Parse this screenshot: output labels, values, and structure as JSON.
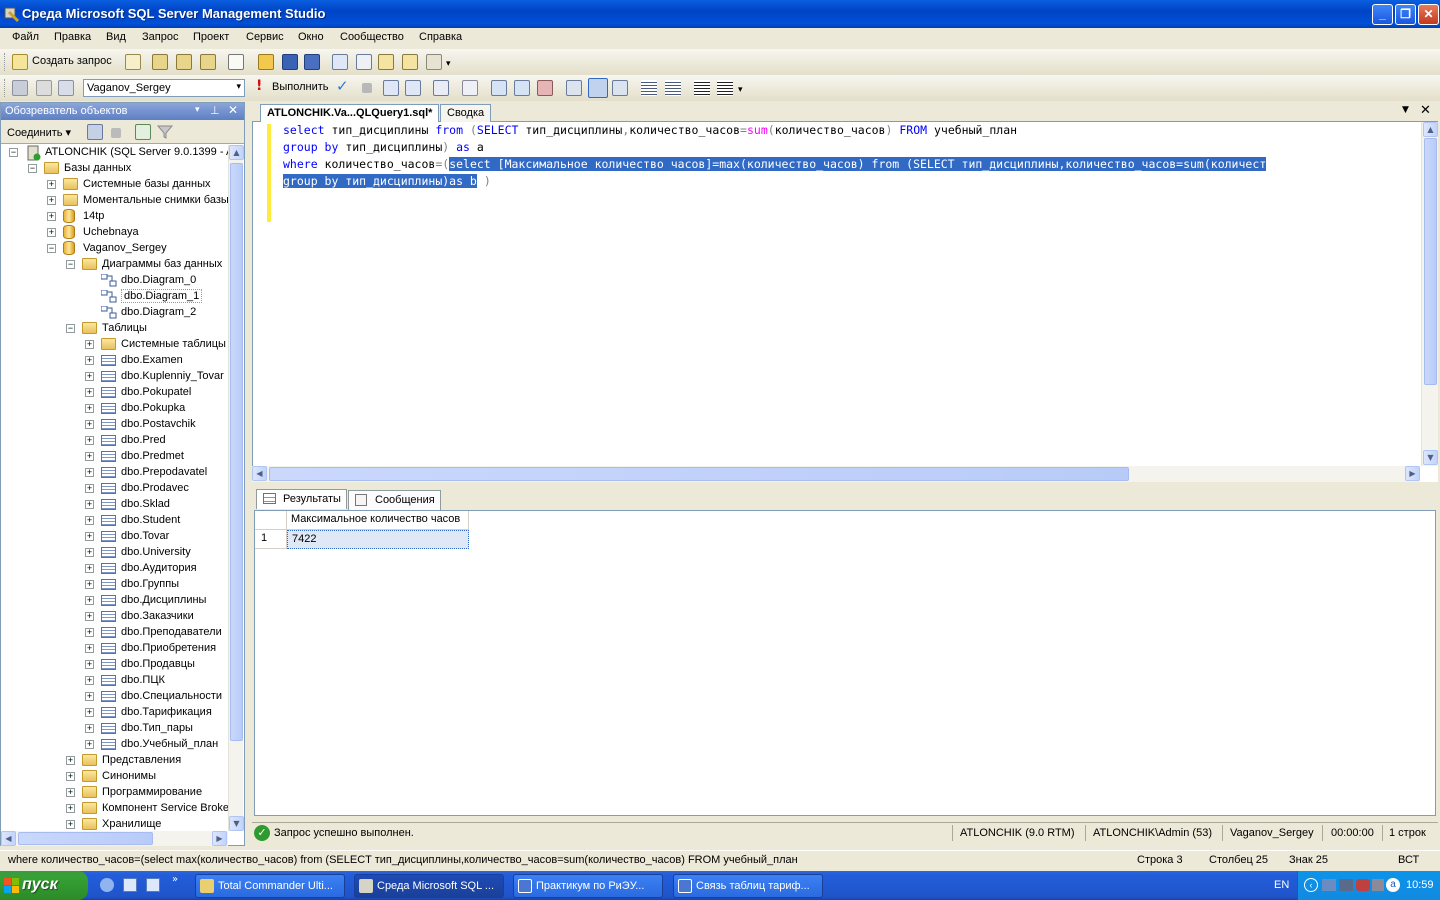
{
  "window": {
    "title": "Среда Microsoft SQL Server Management Studio",
    "buttons": {
      "minimize": "_",
      "maximize": "❐",
      "close": "✕"
    }
  },
  "menu": [
    "Файл",
    "Правка",
    "Вид",
    "Запрос",
    "Проект",
    "Сервис",
    "Окно",
    "Сообщество",
    "Справка"
  ],
  "toolbar1": {
    "new_query": "Создать запрос"
  },
  "toolbar2": {
    "database": "Vaganov_Sergey",
    "execute": "Выполнить"
  },
  "object_explorer": {
    "title": "Обозреватель объектов",
    "connect": "Соединить ▾",
    "tree": [
      {
        "label": "ATLONCHIK (SQL Server 9.0.1399 - A",
        "level": 0,
        "type": "server",
        "exp": "−"
      },
      {
        "label": "Базы данных",
        "level": 1,
        "type": "folder",
        "exp": "−"
      },
      {
        "label": "Системные базы данных",
        "level": 2,
        "type": "folder",
        "exp": "+"
      },
      {
        "label": "Моментальные снимки базы",
        "level": 2,
        "type": "folder",
        "exp": "+"
      },
      {
        "label": "14tp",
        "level": 2,
        "type": "db",
        "exp": "+"
      },
      {
        "label": "Uchebnaya",
        "level": 2,
        "type": "db",
        "exp": "+"
      },
      {
        "label": "Vaganov_Sergey",
        "level": 2,
        "type": "db",
        "exp": "−"
      },
      {
        "label": "Диаграммы баз данных",
        "level": 3,
        "type": "folder",
        "exp": "−"
      },
      {
        "label": "dbo.Diagram_0",
        "level": 4,
        "type": "diagram",
        "exp": ""
      },
      {
        "label": "dbo.Diagram_1",
        "level": 4,
        "type": "diagram",
        "exp": ""
      },
      {
        "label": "dbo.Diagram_2",
        "level": 4,
        "type": "diagram",
        "exp": ""
      },
      {
        "label": "Таблицы",
        "level": 3,
        "type": "folder",
        "exp": "−"
      },
      {
        "label": "Системные таблицы",
        "level": 4,
        "type": "folder",
        "exp": "+"
      },
      {
        "label": "dbo.Examen",
        "level": 4,
        "type": "table",
        "exp": "+"
      },
      {
        "label": "dbo.Kuplenniy_Tovar",
        "level": 4,
        "type": "table",
        "exp": "+"
      },
      {
        "label": "dbo.Pokupatel",
        "level": 4,
        "type": "table",
        "exp": "+"
      },
      {
        "label": "dbo.Pokupka",
        "level": 4,
        "type": "table",
        "exp": "+"
      },
      {
        "label": "dbo.Postavchik",
        "level": 4,
        "type": "table",
        "exp": "+"
      },
      {
        "label": "dbo.Pred",
        "level": 4,
        "type": "table",
        "exp": "+"
      },
      {
        "label": "dbo.Predmet",
        "level": 4,
        "type": "table",
        "exp": "+"
      },
      {
        "label": "dbo.Prepodavatel",
        "level": 4,
        "type": "table",
        "exp": "+"
      },
      {
        "label": "dbo.Prodavec",
        "level": 4,
        "type": "table",
        "exp": "+"
      },
      {
        "label": "dbo.Sklad",
        "level": 4,
        "type": "table",
        "exp": "+"
      },
      {
        "label": "dbo.Student",
        "level": 4,
        "type": "table",
        "exp": "+"
      },
      {
        "label": "dbo.Tovar",
        "level": 4,
        "type": "table",
        "exp": "+"
      },
      {
        "label": "dbo.University",
        "level": 4,
        "type": "table",
        "exp": "+"
      },
      {
        "label": "dbo.Аудитория",
        "level": 4,
        "type": "table",
        "exp": "+"
      },
      {
        "label": "dbo.Группы",
        "level": 4,
        "type": "table",
        "exp": "+"
      },
      {
        "label": "dbo.Дисциплины",
        "level": 4,
        "type": "table",
        "exp": "+"
      },
      {
        "label": "dbo.Заказчики",
        "level": 4,
        "type": "table",
        "exp": "+"
      },
      {
        "label": "dbo.Преподаватели",
        "level": 4,
        "type": "table",
        "exp": "+"
      },
      {
        "label": "dbo.Приобретения",
        "level": 4,
        "type": "table",
        "exp": "+"
      },
      {
        "label": "dbo.Продавцы",
        "level": 4,
        "type": "table",
        "exp": "+"
      },
      {
        "label": "dbo.ПЦК",
        "level": 4,
        "type": "table",
        "exp": "+"
      },
      {
        "label": "dbo.Специальности",
        "level": 4,
        "type": "table",
        "exp": "+"
      },
      {
        "label": "dbo.Тарификация",
        "level": 4,
        "type": "table",
        "exp": "+"
      },
      {
        "label": "dbo.Тип_пары",
        "level": 4,
        "type": "table",
        "exp": "+"
      },
      {
        "label": "dbo.Учебный_план",
        "level": 4,
        "type": "table",
        "exp": "+"
      },
      {
        "label": "Представления",
        "level": 3,
        "type": "folder",
        "exp": "+"
      },
      {
        "label": "Синонимы",
        "level": 3,
        "type": "folder",
        "exp": "+"
      },
      {
        "label": "Программирование",
        "level": 3,
        "type": "folder",
        "exp": "+"
      },
      {
        "label": "Компонент Service Broke",
        "level": 3,
        "type": "folder",
        "exp": "+"
      },
      {
        "label": "Хранилище",
        "level": 3,
        "type": "folder",
        "exp": "+"
      }
    ]
  },
  "editor": {
    "tabs": [
      "ATLONCHIK.Va...QLQuery1.sql*",
      "Сводка"
    ],
    "lines": [
      [
        [
          "kw",
          "select"
        ],
        [
          "t",
          " тип_дисциплины "
        ],
        [
          "kw",
          "from"
        ],
        [
          "t",
          " "
        ],
        [
          "gr",
          "("
        ],
        [
          "kw",
          "SELECT"
        ],
        [
          "t",
          " тип_дисциплины"
        ],
        [
          "gr",
          ","
        ],
        [
          "t",
          "количество_часов"
        ],
        [
          "gr",
          "="
        ],
        [
          "fn",
          "sum"
        ],
        [
          "gr",
          "("
        ],
        [
          "t",
          "количество_часов"
        ],
        [
          "gr",
          ")"
        ],
        [
          "t",
          " "
        ],
        [
          "kw",
          "FROM"
        ],
        [
          "t",
          " учебный_план"
        ]
      ],
      [
        [
          "kw",
          "group by"
        ],
        [
          "t",
          " тип_дисциплины"
        ],
        [
          "gr",
          ")"
        ],
        [
          "t",
          " "
        ],
        [
          "kw",
          "as"
        ],
        [
          "t",
          " a"
        ]
      ],
      [
        [
          "kw",
          "where"
        ],
        [
          "t",
          " количество_часов"
        ],
        [
          "gr",
          "=("
        ],
        [
          "sel",
          "select [Максимальное количество часов]=max(количество_часов) from (SELECT тип_дисциплины,количество_часов=sum(количест"
        ]
      ],
      [
        [
          "sel",
          "group by тип_дисциплины)as b"
        ],
        [
          "t",
          " "
        ],
        [
          "gr",
          ")"
        ]
      ]
    ]
  },
  "results": {
    "tabs": [
      "Результаты",
      "Сообщения"
    ],
    "columns": [
      "Максимальное количество часов"
    ],
    "rows": [
      [
        "1",
        "7422"
      ]
    ]
  },
  "query_status": {
    "message": "Запрос успешно выполнен.",
    "server": "ATLONCHIK (9.0 RTM)",
    "user": "ATLONCHIK\\Admin (53)",
    "database": "Vaganov_Sergey",
    "time": "00:00:00",
    "rows": "1 строк"
  },
  "statusbar": {
    "text": "where количество_часов=(select max(количество_часов) from (SELECT тип_дисциплины,количество_часов=sum(количество_часов) FROM учебный_план",
    "line": "Строка 3",
    "col": "Столбец 25",
    "ch": "Знак 25",
    "mode": "ВСТ"
  },
  "taskbar": {
    "start": "пуск",
    "tasks": [
      "Total Commander Ulti...",
      "Среда Microsoft SQL ...",
      "Практикум по РиЭУ...",
      "Связь таблиц тариф..."
    ],
    "lang": "EN",
    "clock": "10:59"
  }
}
